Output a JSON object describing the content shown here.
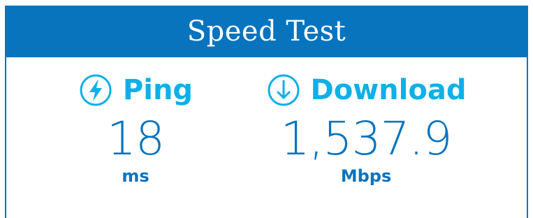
{
  "colors": {
    "header_bg": "#0874be",
    "label": "#0eb0e8",
    "value": "#0874be",
    "background": "#ffffff"
  },
  "header": {
    "title": "Speed Test"
  },
  "metrics": {
    "ping": {
      "icon": "lightning-bolt-icon",
      "label": "Ping",
      "value": "18",
      "unit": "ms"
    },
    "download": {
      "icon": "arrow-down-circle-icon",
      "label": "Download",
      "value": "1,537.9",
      "unit": "Mbps"
    }
  }
}
